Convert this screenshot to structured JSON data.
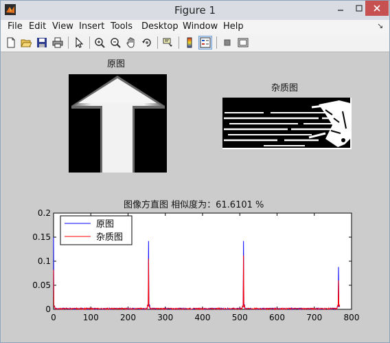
{
  "window": {
    "title": "Figure 1"
  },
  "menu": [
    "File",
    "Edit",
    "View",
    "Insert",
    "Tools",
    "Desktop",
    "Window",
    "Help"
  ],
  "toolbar_icons": [
    "new-figure-icon",
    "open-file-icon",
    "save-icon",
    "print-icon",
    "pointer-icon",
    "zoom-in-icon",
    "zoom-out-icon",
    "pan-hand-icon",
    "rotate-3d-icon",
    "data-cursor-icon",
    "colorbar-icon",
    "legend-icon",
    "hide-plot-tools-icon",
    "show-plot-tools-icon"
  ],
  "subplot1": {
    "title": "原图"
  },
  "subplot2": {
    "title": "杂质图"
  },
  "histogram": {
    "title": "图像方直图 相似度为：61.6101 %"
  },
  "chart_data": {
    "type": "line",
    "title": "图像方直图 相似度为：61.6101 %",
    "xlim": [
      0,
      800
    ],
    "ylim": [
      0,
      0.2
    ],
    "x_ticks": [
      0,
      100,
      200,
      300,
      400,
      500,
      600,
      700,
      800
    ],
    "y_ticks": [
      0,
      0.05,
      0.1,
      0.15,
      0.2
    ],
    "y_tick_labels": [
      "0",
      "0.05",
      "0.1",
      "0.15",
      "0.2"
    ],
    "grid": false,
    "legend_position": "top-left",
    "series": [
      {
        "name": "原图",
        "color": "#0000ff",
        "peaks": [
          [
            0,
            0.15
          ],
          [
            255,
            0.142
          ],
          [
            510,
            0.142
          ],
          [
            765,
            0.088
          ]
        ]
      },
      {
        "name": "杂质图",
        "color": "#ff0000",
        "peaks": [
          [
            0,
            0.082
          ],
          [
            255,
            0.105
          ],
          [
            510,
            0.112
          ],
          [
            765,
            0.06
          ]
        ]
      }
    ]
  }
}
